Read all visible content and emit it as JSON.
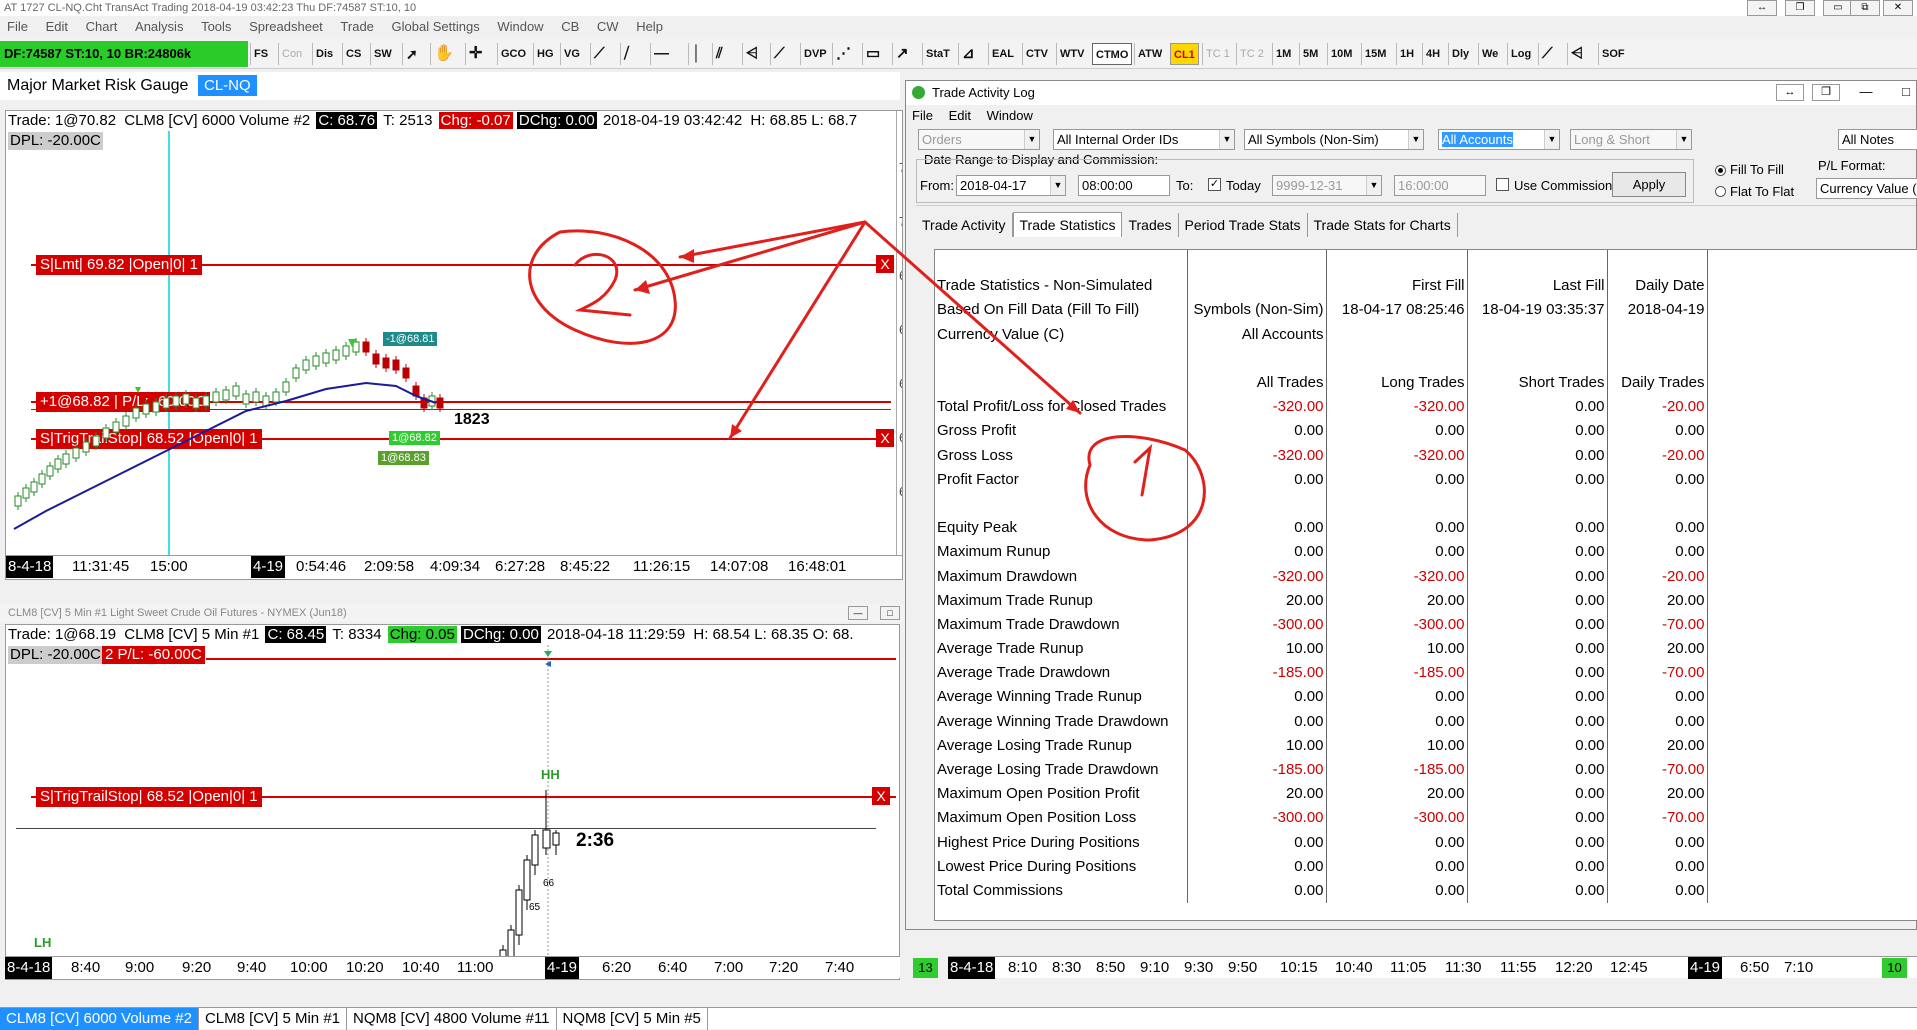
{
  "app": {
    "title": "AT 1727 CL-NQ.Cht  TransAct Trading 2018-04-19  03:42:23 Thu  DF:74587  ST:10, 10",
    "window_controls": [
      "↔",
      "❐",
      "▭",
      "⧉",
      "✕"
    ]
  },
  "menu": [
    "File",
    "Edit",
    "Chart",
    "Analysis",
    "Tools",
    "Spreadsheet",
    "Trade",
    "Global Settings",
    "Window",
    "CB",
    "CW",
    "Help"
  ],
  "status": {
    "text": "DF:74587  ST:10, 10  BR:24806k",
    "color": "#29cc29"
  },
  "toolbar": {
    "buttons": [
      "FS",
      "Con",
      "Dis",
      "CS",
      "SW",
      "GCO",
      "HG",
      "VG",
      "DVP",
      "StaT",
      "EAL",
      "CTV",
      "WTV",
      "CTMO",
      "ATW",
      "CL1",
      "TC 1",
      "TC 2",
      "1M",
      "5M",
      "10M",
      "15M",
      "1H",
      "4H",
      "Dly",
      "We",
      "Log",
      "SOF"
    ],
    "icons": [
      "cursor-icon",
      "hand-icon",
      "crosshair-icon",
      "trendline-icon",
      "hline-icon",
      "vline-icon",
      "channel-icon",
      "fib-icon",
      "rect-icon",
      "arrow-icon",
      "gauge-icon"
    ]
  },
  "chart1": {
    "heading": "Major Market Risk Gauge",
    "tag": "CL-NQ",
    "info": {
      "trade": "Trade: 1@70.82",
      "symbol": "CLM8 [CV]  6000 Volume  #2",
      "close": "C: 68.76",
      "ticks": "T: 2513",
      "chg": "Chg: -0.07",
      "dchg": "DChg: 0.00",
      "datetime": "2018-04-19 03:42:42",
      "hl": "H: 68.85  L: 68.7"
    },
    "dpl": "DPL: -20.00C",
    "orders": [
      {
        "label": "S|Lmt| 69.82 |Open|0| 1"
      },
      {
        "label": "+1@68.82 | P/L: -60.00C"
      },
      {
        "label": "S|TrigTrailStop| 68.52 |Open|0| 1"
      }
    ],
    "close_label": "X",
    "callouts": {
      "sell": "-1@68.81",
      "fill1": "1@68.82",
      "fill2": "1@68.83",
      "count": "1823"
    },
    "xaxis": [
      "8-4-18",
      "11:31:45",
      "15:00",
      "4-19",
      "0:54:46",
      "2:09:58",
      "4:09:34",
      "6:27:28",
      "8:45:22",
      "11:26:15",
      "14:07:08",
      "16:48:01"
    ],
    "yaxis_ticks": [
      "7",
      "7",
      "6",
      "6",
      "6",
      "6",
      "6"
    ]
  },
  "chart2": {
    "title": "CLM8 [CV]  5 Min   #1  Light Sweet Crude Oil Futures - NYMEX (Jun18)",
    "info": {
      "trade": "Trade: 1@68.19",
      "symbol": "CLM8 [CV]   5 Min   #1",
      "close": "C: 68.45",
      "ticks": "T: 8334",
      "chg": "Chg: 0.05",
      "dchg": "DChg: 0.00",
      "datetime": "2018-04-18 11:29:59",
      "hl": "H: 68.54  L: 68.35  O: 68."
    },
    "dpl": "DPL: -20.00C",
    "pl": "2  P/L: -60.00C",
    "order": "S|TrigTrailStop| 68.52 |Open|0| 1",
    "close_label": "X",
    "labels": {
      "hh": "HH",
      "lh": "LH",
      "time": "2:36",
      "n66": "66",
      "n65": "65"
    },
    "xaxis": [
      "8-4-18",
      "8:40",
      "9:00",
      "9:20",
      "9:40",
      "10:00",
      "10:20",
      "10:40",
      "11:00",
      "4-19",
      "6:20",
      "6:40",
      "7:00",
      "7:20",
      "7:40"
    ],
    "badge": "13"
  },
  "chart3": {
    "xaxis": [
      "8-4-18",
      "8:10",
      "8:30",
      "8:50",
      "9:10",
      "9:30",
      "9:50",
      "10:15",
      "10:40",
      "11:05",
      "11:30",
      "11:55",
      "12:20",
      "12:45",
      "4-19",
      "6:50",
      "7:10"
    ],
    "badge": "10"
  },
  "trade_log": {
    "title": "Trade Activity Log",
    "menu": [
      "File",
      "Edit",
      "Window"
    ],
    "filters": {
      "orders": "Orders",
      "order_ids": "All Internal Order IDs",
      "symbols": "All Symbols (Non-Sim)",
      "accounts": "All Accounts",
      "side": "Long & Short",
      "notes": "All Notes"
    },
    "date_range_label": "Date Range to Display and Commission:",
    "from_label": "From:",
    "from_date": "2018-04-17",
    "from_time": "08:00:00",
    "to_label": "To:",
    "today_label": "Today",
    "to_date": "9999-12-31",
    "to_time": "16:00:00",
    "use_commission": "Use Commission",
    "apply": "Apply",
    "fill_to_fill": "Fill To Fill",
    "flat_to_flat": "Flat To Flat",
    "pl_format_label": "P/L Format:",
    "pl_format": "Currency Value (C",
    "tabs": [
      "Trade Activity",
      "Trade Statistics",
      "Trades",
      "Period Trade Stats",
      "Trade Stats for Charts"
    ],
    "stats": {
      "head1": [
        "Trade Statistics - Non-Simulated",
        "",
        "First Fill",
        "Last Fill",
        "Daily Date"
      ],
      "head2": [
        "Based On Fill Data (Fill To Fill)",
        "Symbols (Non-Sim)",
        "18-04-17  08:25:46",
        "18-04-19  03:35:37",
        "2018-04-19"
      ],
      "head3": [
        "Currency Value (C)",
        "All Accounts",
        "",
        "",
        ""
      ],
      "cols": [
        "",
        "All Trades",
        "Long Trades",
        "Short Trades",
        "Daily Trades"
      ],
      "rows": [
        [
          "Total Profit/Loss for Closed Trades",
          "-320.00",
          "-320.00",
          "0.00",
          "-20.00"
        ],
        [
          "Gross Profit",
          "0.00",
          "0.00",
          "0.00",
          "0.00"
        ],
        [
          "Gross Loss",
          "-320.00",
          "-320.00",
          "0.00",
          "-20.00"
        ],
        [
          "Profit Factor",
          "0.00",
          "0.00",
          "0.00",
          "0.00"
        ],
        [
          "",
          "",
          "",
          "",
          ""
        ],
        [
          "Equity Peak",
          "0.00",
          "0.00",
          "0.00",
          "0.00"
        ],
        [
          "Maximum Runup",
          "0.00",
          "0.00",
          "0.00",
          "0.00"
        ],
        [
          "Maximum Drawdown",
          "-320.00",
          "-320.00",
          "0.00",
          "-20.00"
        ],
        [
          "Maximum Trade Runup",
          "20.00",
          "20.00",
          "0.00",
          "20.00"
        ],
        [
          "Maximum Trade Drawdown",
          "-300.00",
          "-300.00",
          "0.00",
          "-70.00"
        ],
        [
          "Average Trade Runup",
          "10.00",
          "10.00",
          "0.00",
          "20.00"
        ],
        [
          "Average Trade Drawdown",
          "-185.00",
          "-185.00",
          "0.00",
          "-70.00"
        ],
        [
          "Average Winning Trade Runup",
          "0.00",
          "0.00",
          "0.00",
          "0.00"
        ],
        [
          "Average Winning Trade Drawdown",
          "0.00",
          "0.00",
          "0.00",
          "0.00"
        ],
        [
          "Average Losing Trade Runup",
          "10.00",
          "10.00",
          "0.00",
          "20.00"
        ],
        [
          "Average Losing Trade Drawdown",
          "-185.00",
          "-185.00",
          "0.00",
          "-70.00"
        ],
        [
          "Maximum Open Position Profit",
          "20.00",
          "20.00",
          "0.00",
          "20.00"
        ],
        [
          "Maximum Open Position Loss",
          "-300.00",
          "-300.00",
          "0.00",
          "-70.00"
        ],
        [
          "Highest Price During Positions",
          "0.00",
          "0.00",
          "0.00",
          "0.00"
        ],
        [
          "Lowest Price During Positions",
          "0.00",
          "0.00",
          "0.00",
          "0.00"
        ],
        [
          "Total Commissions",
          "0.00",
          "0.00",
          "0.00",
          "0.00"
        ]
      ]
    }
  },
  "bottom_tabs": [
    "CLM8 [CV]  6000 Volume  #2",
    "CLM8 [CV]  5 Min   #1",
    "NQM8 [CV]  4800 Volume  #11",
    "NQM8 [CV]  5 Min   #5"
  ],
  "colors": {
    "order_red": "#d40000",
    "accent_blue": "#1e90ff",
    "neg": "#cc0000",
    "annotation": "#e0201c"
  }
}
